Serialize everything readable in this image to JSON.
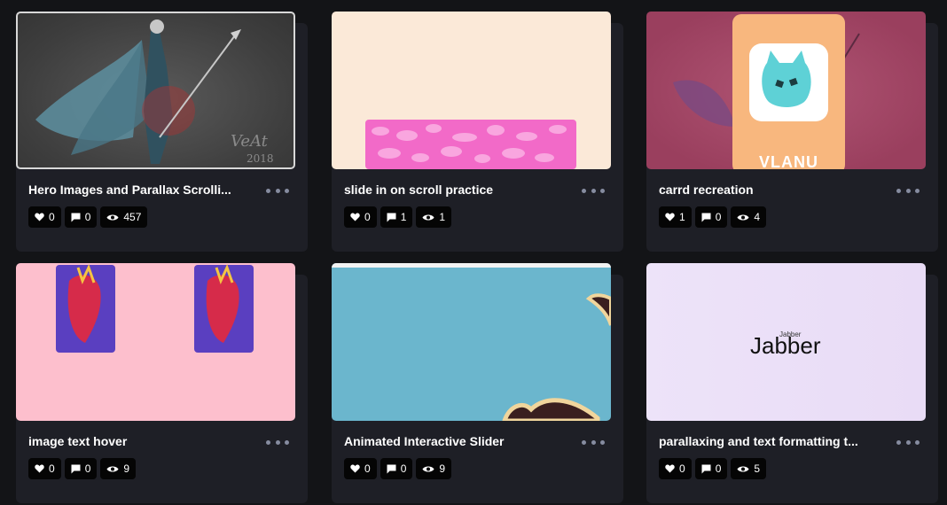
{
  "cards": [
    {
      "title": "Hero Images and Parallax Scrolli...",
      "likes": "0",
      "comments": "0",
      "views": "457"
    },
    {
      "title": "slide in on scroll practice",
      "likes": "0",
      "comments": "1",
      "views": "1"
    },
    {
      "title": "carrd recreation",
      "likes": "1",
      "comments": "0",
      "views": "4",
      "thumb_text": "VLANU"
    },
    {
      "title": "image text hover",
      "likes": "0",
      "comments": "0",
      "views": "9"
    },
    {
      "title": "Animated Interactive Slider",
      "likes": "0",
      "comments": "0",
      "views": "9"
    },
    {
      "title": "parallaxing and text formatting t...",
      "likes": "0",
      "comments": "0",
      "views": "5",
      "thumb_text": "Jabber",
      "thumb_small_text": "Jabber"
    }
  ],
  "colors": {
    "page_bg": "#131417",
    "card_bg": "#1e1f26",
    "stat_bg": "#050505",
    "more_dots": "#868ca0"
  }
}
